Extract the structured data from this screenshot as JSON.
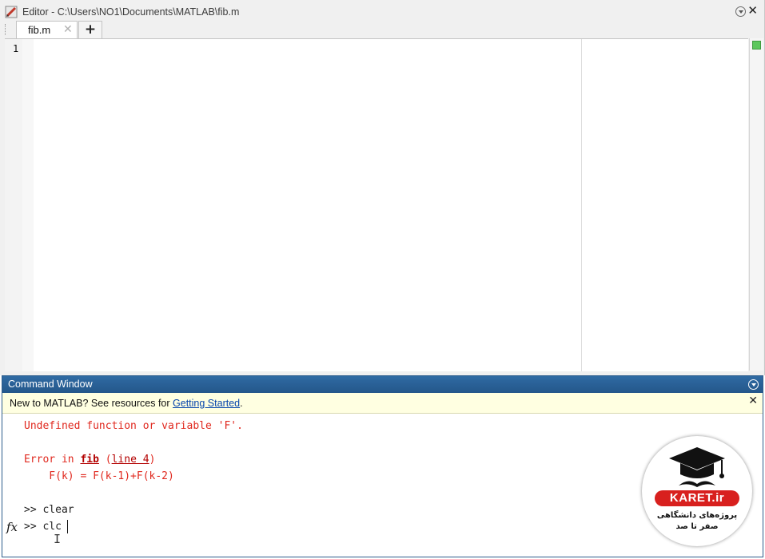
{
  "editor": {
    "title": "Editor - C:\\Users\\NO1\\Documents\\MATLAB\\fib.m",
    "tabs": [
      {
        "label": "fib.m",
        "close": "✕"
      }
    ],
    "new_tab": "+",
    "close": "✕",
    "line_numbers": [
      "1"
    ],
    "status_color": "#5cc75c"
  },
  "command_window": {
    "title": "Command Window",
    "notice": {
      "prefix": "New to MATLAB? See resources for ",
      "link": "Getting Started",
      "suffix": ".",
      "close": "✕"
    },
    "lines": {
      "err1": "Undefined function or variable 'F'.",
      "err2_prefix": "Error in ",
      "err2_func": "fib",
      "err2_mid": " (",
      "err2_link": "line 4",
      "err2_suffix": ")",
      "err3": "    F(k) = F(k-1)+F(k-2)",
      "cmd1": ">> clear",
      "cmd2": ">> clc"
    },
    "fx_label": "fx",
    "error_color": "#e0281e"
  },
  "watermark": {
    "brand": "KARET.ir",
    "line1": "پروژه‌های دانشگاهی",
    "line2": "صفر تا صد"
  }
}
